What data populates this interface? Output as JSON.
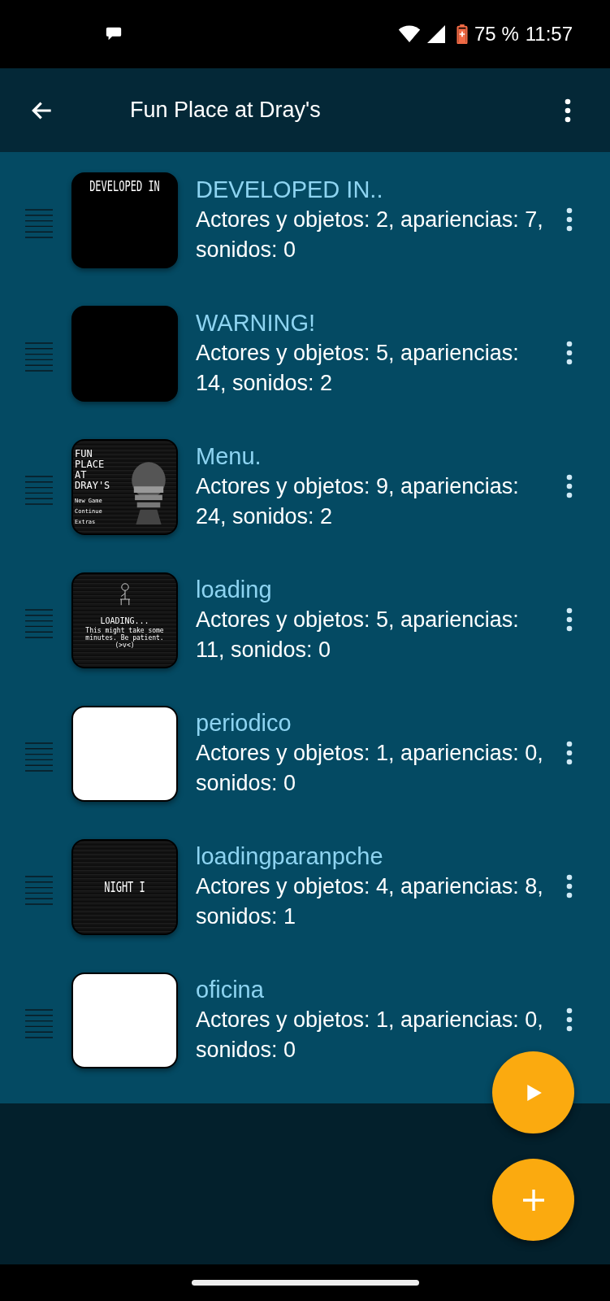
{
  "status_bar": {
    "battery": "75 %",
    "time": "11:57"
  },
  "app_bar": {
    "title": "Fun Place at Dray's"
  },
  "scenes": [
    {
      "name": "DEVELOPED IN..",
      "details": "Actores y objetos: 2, apariencias: 7, sonidos: 0",
      "thumbnail": {
        "kind": "caption-top",
        "lines": [
          "DEVELOPED IN"
        ]
      }
    },
    {
      "name": "WARNING!",
      "details": "Actores y objetos: 5, apariencias: 14, sonidos: 2",
      "thumbnail": {
        "kind": "black"
      }
    },
    {
      "name": "Menu.",
      "details": "Actores y objetos: 9, apariencias: 24, sonidos: 2",
      "thumbnail": {
        "kind": "menu",
        "lines": [
          "FUN",
          "PLACE",
          "AT",
          "DRAY'S"
        ],
        "options": [
          "New Game",
          "Continue",
          "Extras"
        ]
      }
    },
    {
      "name": "loading",
      "details": "Actores y objetos: 5, apariencias: 11, sonidos: 0",
      "thumbnail": {
        "kind": "loading",
        "lines": [
          "LOADING...",
          "This might take some minutes. Be patient. (>v<)"
        ]
      }
    },
    {
      "name": "periodico",
      "details": "Actores y objetos: 1, apariencias: 0, sonidos: 0",
      "thumbnail": {
        "kind": "white"
      }
    },
    {
      "name": "loadingparanpche",
      "details": "Actores y objetos: 4, apariencias: 8, sonidos: 1",
      "thumbnail": {
        "kind": "caption-center",
        "lines": [
          "NIGHT I"
        ]
      }
    },
    {
      "name": "oficina",
      "details": "Actores y objetos: 1, apariencias: 0, sonidos: 0",
      "thumbnail": {
        "kind": "white"
      }
    }
  ]
}
